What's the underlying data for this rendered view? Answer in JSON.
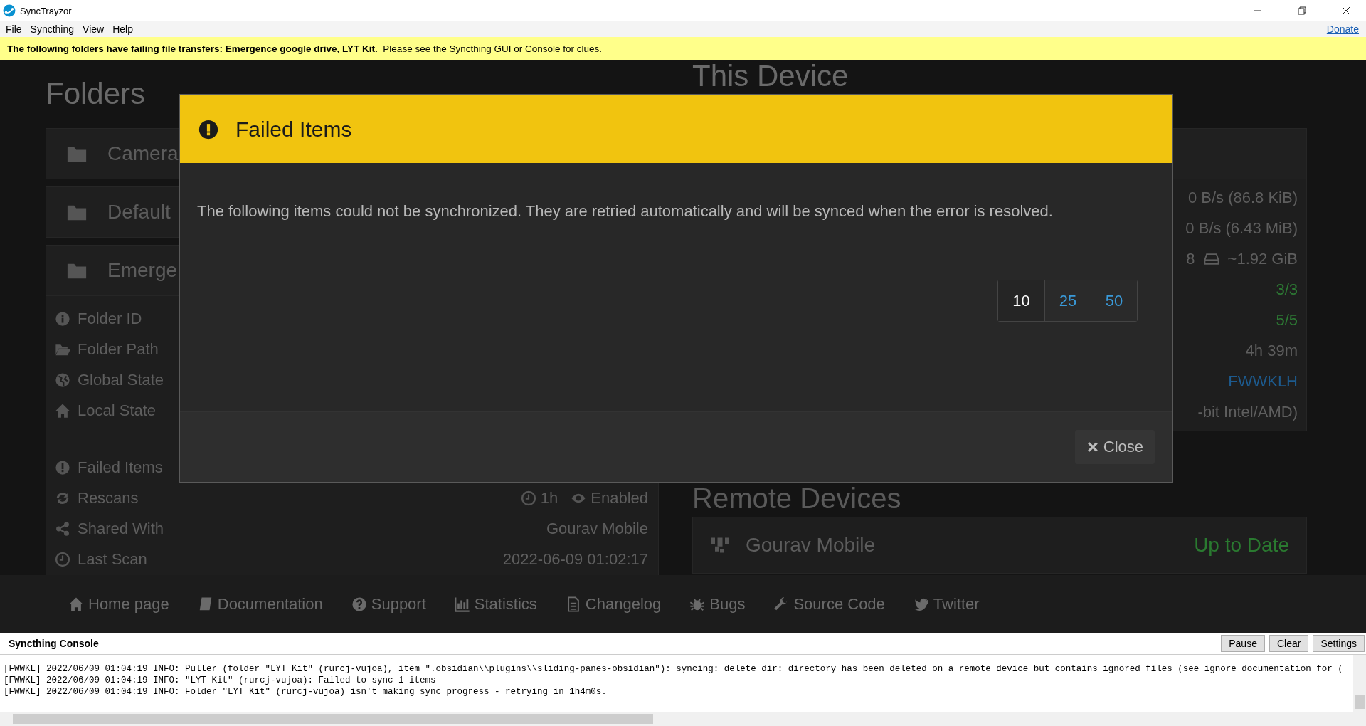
{
  "window": {
    "title": "SyncTrayzor"
  },
  "menu": [
    {
      "label": "File"
    },
    {
      "label": "Syncthing"
    },
    {
      "label": "View"
    },
    {
      "label": "Help"
    }
  ],
  "donate_link": "Donate",
  "banner": "**The following folders have failing file transfers: Emergence google drive, LYT Kit.**  Please see the Syncthing GUI or Console for clues.",
  "folders": {
    "title": "Folders",
    "panels": [
      {
        "name": "Camera",
        "expanded": false
      },
      {
        "name": "Default",
        "expanded": false
      },
      {
        "name": "Emerge",
        "expanded": true
      }
    ],
    "details": [
      {
        "label": "Folder ID"
      },
      {
        "label": "Folder Path"
      },
      {
        "label": "Global State"
      },
      {
        "label": "Local State"
      },
      {
        "label": "Failed Items"
      },
      {
        "label": "Rescans",
        "values": [
          "1h",
          "Enabled"
        ]
      },
      {
        "label": "Shared With",
        "values": [
          "Gourav Mobile"
        ]
      },
      {
        "label": "Last Scan",
        "values": [
          "2022-06-09 01:02:17"
        ]
      }
    ]
  },
  "this_device": {
    "title": "This Device",
    "rows": [
      {
        "values": [
          "0 B/s (86.8 KiB)"
        ],
        "kind": "plain"
      },
      {
        "values": [
          "0 B/s (6.43 MiB)"
        ],
        "kind": "plain"
      },
      {
        "values": [
          "8",
          "~1.92 GiB"
        ],
        "kind": "disk"
      },
      {
        "values": [
          "3/3"
        ],
        "kind": "ok"
      },
      {
        "values": [
          "5/5"
        ],
        "kind": "ok"
      },
      {
        "values": [
          "4h 39m"
        ],
        "kind": "plain"
      },
      {
        "values": [
          "FWWKLH"
        ],
        "kind": "link"
      },
      {
        "values": [
          "-bit Intel/AMD)"
        ],
        "kind": "plain"
      }
    ]
  },
  "remote_devices": {
    "title": "Remote Devices",
    "devices": [
      {
        "name": "Gourav Mobile",
        "status": "Up to Date"
      }
    ]
  },
  "modal": {
    "title": "Failed Items",
    "message": "The following items could not be synchronized. They are retried automatically and will be synced when the error is resolved.",
    "page_sizes": [
      {
        "label": "10",
        "selected": true
      },
      {
        "label": "25",
        "selected": false
      },
      {
        "label": "50",
        "selected": false
      }
    ],
    "close_button": "Close"
  },
  "footer_links": [
    {
      "label": "Home page"
    },
    {
      "label": "Documentation"
    },
    {
      "label": "Support"
    },
    {
      "label": "Statistics"
    },
    {
      "label": "Changelog"
    },
    {
      "label": "Bugs"
    },
    {
      "label": "Source Code"
    },
    {
      "label": "Twitter"
    }
  ],
  "console": {
    "title": "Syncthing Console",
    "buttons": [
      {
        "label": "Pause"
      },
      {
        "label": "Clear"
      },
      {
        "label": "Settings"
      }
    ],
    "lines": [
      "[FWWKL] 2022/06/09 01:04:19 INFO: Puller (folder \"LYT Kit\" (rurcj-vujoa), item \".obsidian\\\\plugins\\\\sliding-panes-obsidian\"): syncing: delete dir: directory has been deleted on a remote device but contains ignored files (see ignore documentation for (",
      "[FWWKL] 2022/06/09 01:04:19 INFO: \"LYT Kit\" (rurcj-vujoa): Failed to sync 1 items",
      "[FWWKL] 2022/06/09 01:04:19 INFO: Folder \"LYT Kit\" (rurcj-vujoa) isn't making sync progress - retrying in 1h4m0s."
    ]
  }
}
